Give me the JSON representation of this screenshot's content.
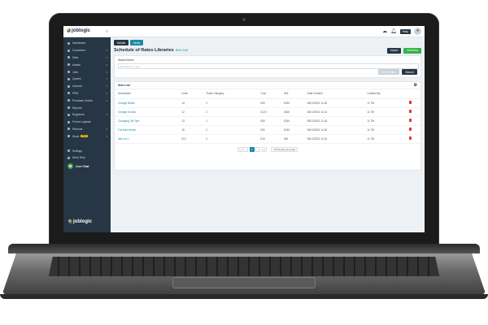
{
  "app": {
    "brand": "joblogic",
    "help_label": "Help"
  },
  "sidebar": {
    "items": [
      {
        "label": "Dashboard",
        "chev": false
      },
      {
        "label": "Customers",
        "chev": true
      },
      {
        "label": "Sites",
        "chev": true
      },
      {
        "label": "Assets",
        "chev": true
      },
      {
        "label": "Jobs",
        "chev": true
      },
      {
        "label": "Quotes",
        "chev": true
      },
      {
        "label": "Invoices",
        "chev": true
      },
      {
        "label": "PPM",
        "chev": true
      },
      {
        "label": "Purchase Orders",
        "chev": true
      },
      {
        "label": "Reports",
        "chev": false
      },
      {
        "label": "Engineers",
        "chev": true
      },
      {
        "label": "Forms Logbook",
        "chev": false
      },
      {
        "label": "Refunds",
        "chev": true
      },
      {
        "label": "Stock",
        "chev": true,
        "badge": "New"
      }
    ],
    "settings_label": "Settings",
    "help_label": "Need Help",
    "live_chat_label": "Live Chat"
  },
  "main": {
    "tabs": [
      "Details",
      "Items"
    ],
    "title": "Schedule of Rates Libraries",
    "subtitle": "NEW SoR",
    "import_label": "Import",
    "add_item_label": "Add Item",
    "search": {
      "label": "Search Items",
      "placeholder": "Description, Code",
      "clear_label": "Clear Filters",
      "search_label": "Search"
    },
    "list": {
      "title": "Item List",
      "columns": [
        "Description",
        "Code",
        "Trade Category",
        "Cost",
        "Sell",
        "Date Created",
        "Created By"
      ],
      "rows": [
        [
          "Change Bricks",
          "14",
          "2",
          "£50",
          "£150",
          "06/12/2021 11:16",
          "JL TM"
        ],
        [
          "Change Domes",
          "12",
          "2",
          "£120",
          "£300",
          "06/12/2021 11:16",
          "JL TM"
        ],
        [
          "Changing Toil Tyre",
          "13",
          "1",
          "£50",
          "£150",
          "06/12/2021 11:16",
          "JL TM"
        ],
        [
          "Full toilet steam",
          "15",
          "2",
          "£50",
          "£150",
          "06/12/2021 11:16",
          "JL TM"
        ],
        [
          "Item no 1",
          "013",
          "0",
          "£15",
          "£50",
          "06/12/2021 11:16",
          "JL TM"
        ]
      ]
    },
    "pager": {
      "first": "«",
      "prev": "‹",
      "current": "1",
      "next": "›",
      "last": "»",
      "per_page": "10 Results per page"
    }
  },
  "colors": {
    "sidebar": "#263645",
    "accent": "#1c8aa6",
    "green": "#36b24a",
    "delete": "#e53935"
  }
}
